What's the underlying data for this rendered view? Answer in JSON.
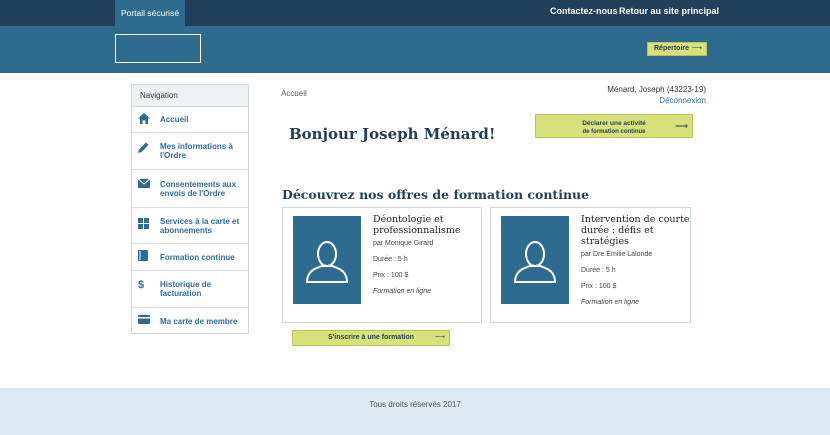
{
  "topbar": {
    "portal_tab": "Portail sécurisé",
    "contact": "Contactez-nous",
    "main_site": "Retour au site principal"
  },
  "banner": {
    "repertoire": "Répertoire"
  },
  "sidebar": {
    "header": "Navigation",
    "items": [
      {
        "label": "Accueil",
        "icon": "home-icon"
      },
      {
        "label": "Mes informations à l'Ordre",
        "icon": "pencil-icon"
      },
      {
        "label": "Consentements aux envois de l'Ordre",
        "icon": "envelope-icon"
      },
      {
        "label": "Services à la carte et abonnements",
        "icon": "grid-icon"
      },
      {
        "label": "Formation continue",
        "icon": "book-icon"
      },
      {
        "label": "Historique de facturation",
        "icon": "dollar-icon"
      },
      {
        "label": "Ma carte de membre",
        "icon": "card-icon"
      }
    ]
  },
  "main": {
    "breadcrumb": "Accueil",
    "user": "Ménard, Joseph (43223-19)",
    "logout": "Déconnexion",
    "greeting": "Bonjour Joseph Ménard!",
    "declare_line1": "Déclarer une activité",
    "declare_line2": "de formation continue",
    "offers_title": "Découvrez nos offres de formation continue",
    "enroll": "S'inscrire à une formation",
    "cards": [
      {
        "title": "Déontologie et professionnalisme",
        "author": "par Monique Girard",
        "duration": "Durée : 5 h",
        "price": "Prix : 100 $",
        "mode": "Formation en ligne"
      },
      {
        "title": "Intervention de courte durée : défis et stratégies",
        "author": "par Dre Émilie Lalonde",
        "duration": "Durée : 5 h",
        "price": "Prix : 100 $",
        "mode": "Formation en ligne"
      }
    ]
  },
  "footer": {
    "copyright": "Tous droits réservés 2017"
  },
  "colors": {
    "navy": "#1f3f5a",
    "blue": "#2f6b8f",
    "lime": "#d9e27a",
    "link": "#2a6aa8"
  }
}
